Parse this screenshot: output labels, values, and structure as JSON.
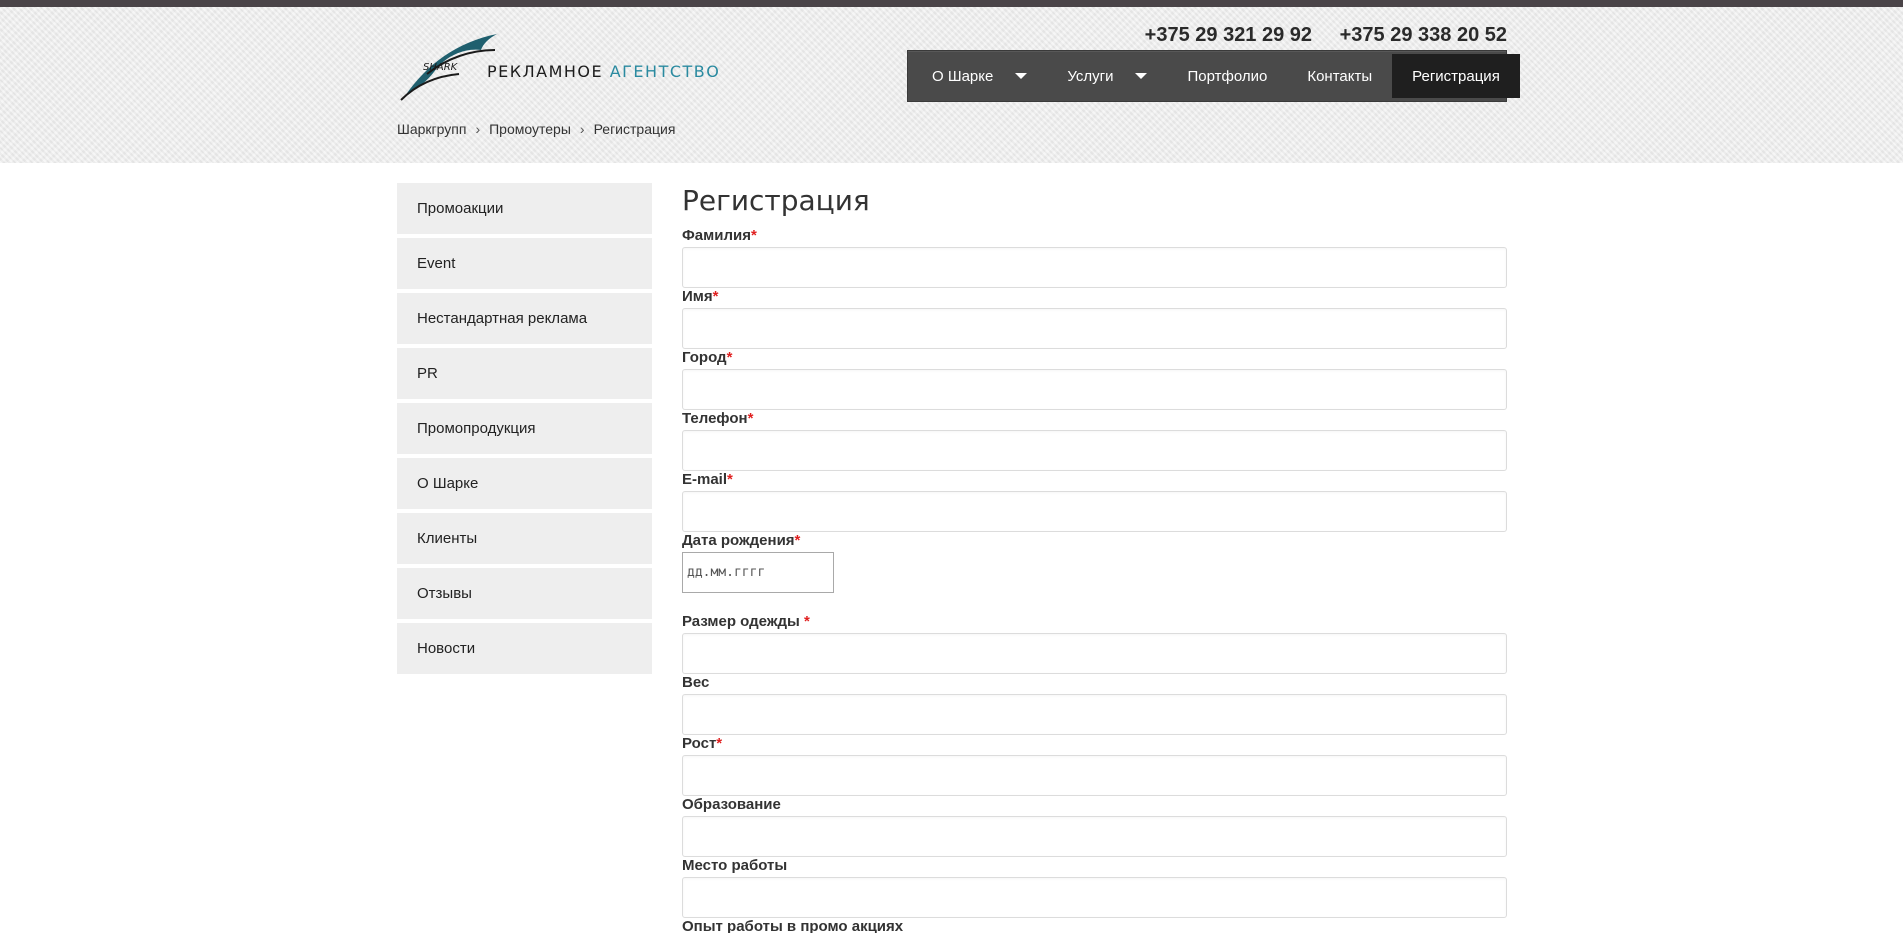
{
  "logo": {
    "brand": "SHARK",
    "text_main": "РЕКЛАМНОЕ ",
    "text_accent": "АГЕНТСТВО"
  },
  "phones": [
    "+375 29 321 29 92",
    "+375 29 338 20 52"
  ],
  "nav": {
    "items": [
      {
        "label": "О Шарке"
      },
      {
        "label": "Услуги"
      },
      {
        "label": "Портфолио"
      },
      {
        "label": "Контакты"
      },
      {
        "label": "Регистрация"
      }
    ]
  },
  "breadcrumb": {
    "items": [
      "Шаркгрупп",
      "Промоутеры",
      "Регистрация"
    ],
    "separator": "›"
  },
  "sidebar": {
    "items": [
      {
        "label": "Промоакции"
      },
      {
        "label": "Event"
      },
      {
        "label": "Нестандартная реклама"
      },
      {
        "label": "PR"
      },
      {
        "label": "Промопродукция"
      },
      {
        "label": "О Шарке"
      },
      {
        "label": "Клиенты"
      },
      {
        "label": "Отзывы"
      },
      {
        "label": "Новости"
      }
    ]
  },
  "form": {
    "title": "Регистрация",
    "required_mark": "*",
    "fields": {
      "lastname": {
        "label": "Фамилия",
        "value": ""
      },
      "firstname": {
        "label": "Имя",
        "value": ""
      },
      "city": {
        "label": "Город",
        "value": ""
      },
      "phone": {
        "label": "Телефон",
        "value": ""
      },
      "email": {
        "label": "E-mail",
        "value": ""
      },
      "birthdate": {
        "label": "Дата рождения",
        "placeholder": "дд.мм.гггг"
      },
      "size": {
        "label": "Размер одежды ",
        "value": ""
      },
      "weight": {
        "label": "Вес",
        "value": ""
      },
      "height": {
        "label": "Рост",
        "value": ""
      },
      "education": {
        "label": "Образование",
        "value": ""
      },
      "workplace": {
        "label": "Место работы",
        "value": ""
      },
      "promo_experience": {
        "label": "Опыт работы в промо акциях"
      }
    }
  },
  "colors": {
    "accent": "#2a8aa0",
    "nav_bg": "#4a4a4a",
    "nav_active": "#1f1f1f",
    "required": "#e02020",
    "sidebar_bg": "#eeeeee"
  }
}
